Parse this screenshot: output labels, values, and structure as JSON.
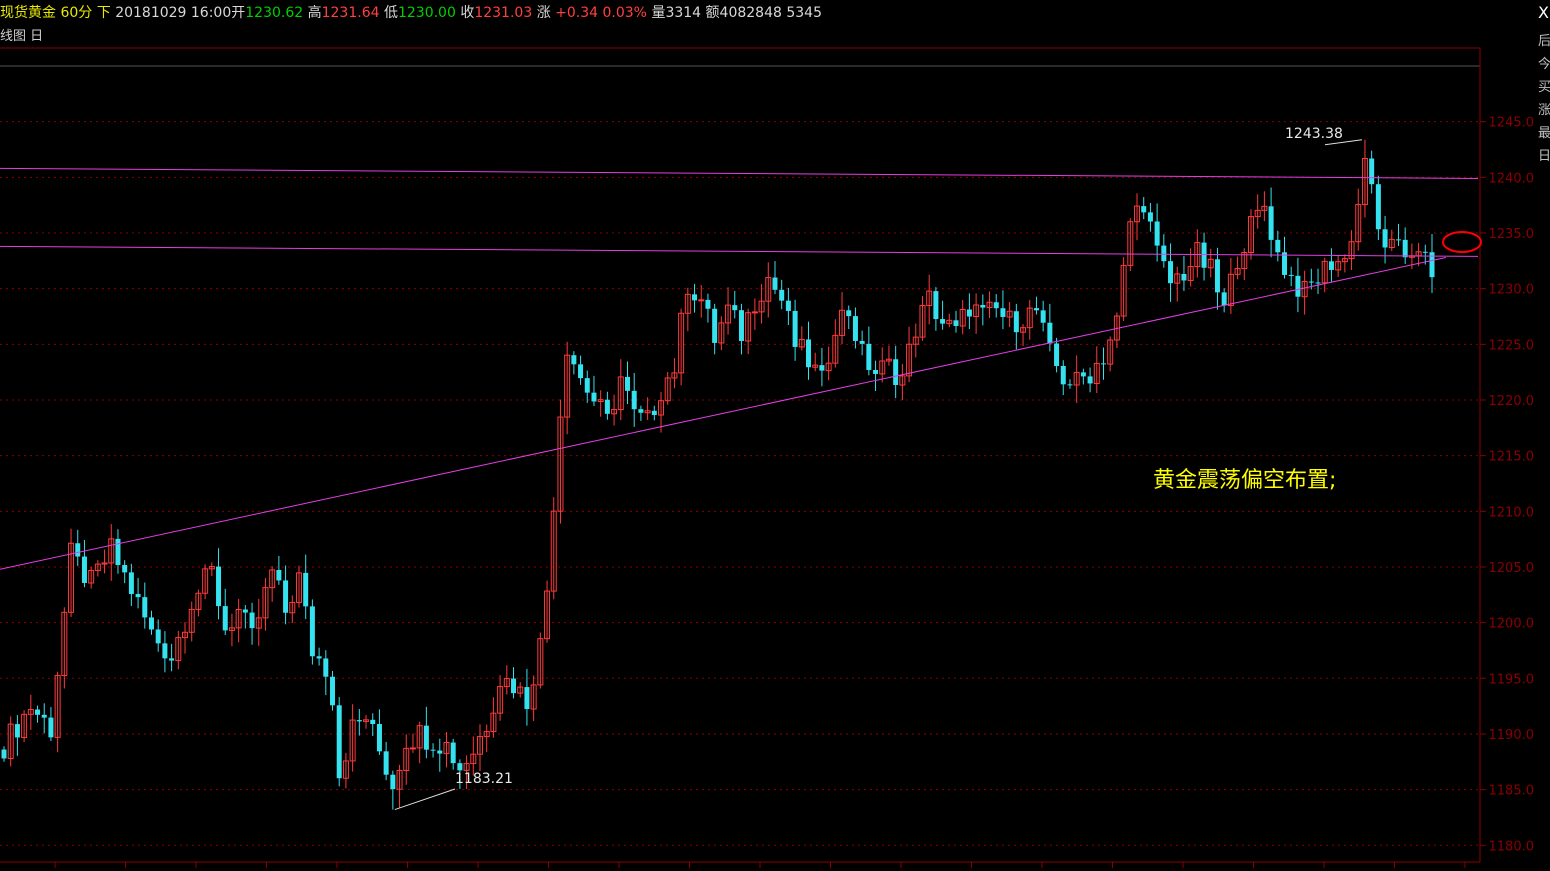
{
  "header": {
    "instrument": "现货黄金",
    "period": "60分",
    "direction": "下",
    "datetime": "20181029 16:00",
    "open_label": "开",
    "open": "1230.62",
    "high_label": "高",
    "high": "1231.64",
    "low_label": "低",
    "low": "1230.00",
    "close_label": "收",
    "close": "1231.03",
    "change_label": "涨",
    "change": "+0.34",
    "change_pct": "0.03%",
    "volume_label": "量",
    "volume": "3314",
    "amount_label": "额",
    "amount": "4082848",
    "extra": "5345"
  },
  "subheader": {
    "label": "线图",
    "icon": "collapse-icon"
  },
  "close_button": "X",
  "side_panel_chars": [
    "后",
    "今",
    "买",
    "涨",
    "最",
    "日"
  ],
  "colors": {
    "up": "#ff3b3b",
    "down": "#35e2ef",
    "trendline": "#e040e0",
    "grid": "#8b0000",
    "annotation": "#ffff00",
    "ellipse": "#ff0000"
  },
  "annotation_text": "黄金震荡偏空布置;",
  "chart_data": {
    "type": "candlestick",
    "title": "",
    "ylim": [
      1178.5,
      1250
    ],
    "y_ticks": [
      "1245.0",
      "1240.0",
      "1235.0",
      "1230.0",
      "1225.0",
      "1220.0",
      "1215.0",
      "1210.0",
      "1205.0",
      "1200.0",
      "1195.0",
      "1190.0",
      "1185.0",
      "1180.0"
    ],
    "grid": true,
    "labels": [
      {
        "text": "1243.38",
        "value": 1243.38,
        "note": "high"
      },
      {
        "text": "1183.21",
        "value": 1183.21,
        "note": "low"
      }
    ],
    "lines": [
      {
        "name": "resistance-line-1",
        "from": 1240.8,
        "to": 1239.9
      },
      {
        "name": "resistance-line-2",
        "from": 1233.8,
        "to": 1232.9
      },
      {
        "name": "support-trendline",
        "from": 1204.8,
        "to": 1232.8
      }
    ],
    "path": [
      [
        0,
        1189.0
      ],
      [
        4,
        1192.5
      ],
      [
        7,
        1190.5
      ],
      [
        10,
        1206
      ],
      [
        13,
        1203.5
      ],
      [
        16,
        1206.5
      ],
      [
        19,
        1203
      ],
      [
        22,
        1199
      ],
      [
        25,
        1197
      ],
      [
        28,
        1202
      ],
      [
        31,
        1204.5
      ],
      [
        33,
        1199.5
      ],
      [
        35,
        1201
      ],
      [
        37,
        1198.5
      ],
      [
        40,
        1204.5
      ],
      [
        42,
        1201
      ],
      [
        44,
        1204
      ],
      [
        46,
        1197.5
      ],
      [
        48,
        1196
      ],
      [
        49,
        1193.5
      ],
      [
        50,
        1186.5
      ],
      [
        52,
        1190.5
      ],
      [
        54,
        1191.5
      ],
      [
        56,
        1188.5
      ],
      [
        58,
        1185.5
      ],
      [
        60,
        1189.5
      ],
      [
        62,
        1190
      ],
      [
        64,
        1189.5
      ],
      [
        66,
        1189
      ],
      [
        68,
        1187
      ],
      [
        70,
        1188.5
      ],
      [
        72,
        1191
      ],
      [
        74,
        1195
      ],
      [
        76,
        1194.5
      ],
      [
        78,
        1193
      ],
      [
        80,
        1198
      ],
      [
        81,
        1203
      ],
      [
        82,
        1211
      ],
      [
        83,
        1219
      ],
      [
        84,
        1225
      ],
      [
        86,
        1222
      ],
      [
        88,
        1220
      ],
      [
        90,
        1218
      ],
      [
        92,
        1222
      ],
      [
        94,
        1218.5
      ],
      [
        96,
        1218
      ],
      [
        98,
        1221
      ],
      [
        100,
        1223
      ],
      [
        102,
        1230.5
      ],
      [
        104,
        1229
      ],
      [
        106,
        1225.5
      ],
      [
        108,
        1228
      ],
      [
        110,
        1226
      ],
      [
        112,
        1229
      ],
      [
        114,
        1231
      ],
      [
        116,
        1229
      ],
      [
        118,
        1225
      ],
      [
        120,
        1223.5
      ],
      [
        122,
        1221.5
      ],
      [
        124,
        1227
      ],
      [
        126,
        1228
      ],
      [
        128,
        1224
      ],
      [
        130,
        1222.5
      ],
      [
        132,
        1223
      ],
      [
        134,
        1222
      ],
      [
        136,
        1226.5
      ],
      [
        138,
        1229
      ],
      [
        140,
        1227
      ],
      [
        142,
        1226
      ],
      [
        144,
        1228.5
      ],
      [
        146,
        1227.5
      ],
      [
        148,
        1228
      ],
      [
        150,
        1227
      ],
      [
        152,
        1227.5
      ],
      [
        154,
        1228
      ],
      [
        156,
        1224
      ],
      [
        158,
        1222
      ],
      [
        160,
        1221.5
      ],
      [
        162,
        1222.5
      ],
      [
        164,
        1224
      ],
      [
        166,
        1227
      ],
      [
        168,
        1236
      ],
      [
        170,
        1238
      ],
      [
        172,
        1233
      ],
      [
        174,
        1230.5
      ],
      [
        176,
        1231.5
      ],
      [
        178,
        1233
      ],
      [
        180,
        1231.5
      ],
      [
        182,
        1228
      ],
      [
        184,
        1233
      ],
      [
        186,
        1235.5
      ],
      [
        188,
        1237.5
      ],
      [
        190,
        1233
      ],
      [
        192,
        1231
      ],
      [
        194,
        1229.5
      ],
      [
        196,
        1231
      ],
      [
        198,
        1232.5
      ],
      [
        200,
        1232.5
      ],
      [
        202,
        1237.5
      ],
      [
        203,
        1242
      ],
      [
        205,
        1235
      ],
      [
        207,
        1233.5
      ],
      [
        209,
        1233
      ],
      [
        211,
        1234
      ],
      [
        213,
        1231.03
      ]
    ]
  }
}
